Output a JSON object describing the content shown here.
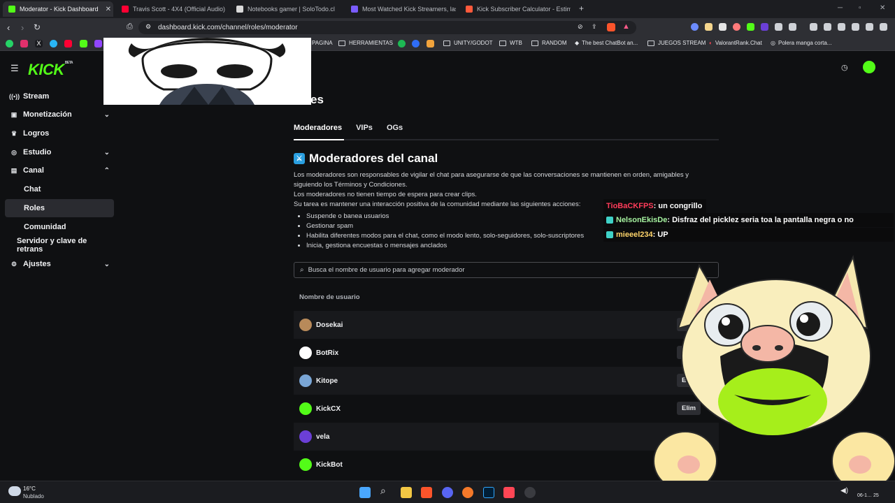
{
  "tabs": [
    {
      "label": "Moderator - Kick Dashboard",
      "active": true,
      "color": "#53fc18"
    },
    {
      "label": "Travis Scott - 4X4 (Official Audio)",
      "active": false,
      "color": "#ff0033"
    },
    {
      "label": "Notebooks gamer | SoloTodo.cl",
      "active": false,
      "color": "#d9d9d9"
    },
    {
      "label": "Most Watched Kick Streamers, last 7",
      "active": false,
      "color": "#7a5cff"
    },
    {
      "label": "Kick Subscriber Calculator - Estimate",
      "active": false,
      "color": "#ff5a3c"
    }
  ],
  "address": {
    "url": "dashboard.kick.com/channel/roles/moderator"
  },
  "bookmarks": [
    "PAGINA",
    "HERRAMIENTAS",
    "UNITY/GODOT",
    "WTB",
    "RANDOM",
    "The best ChatBot an...",
    "JUEGOS STREAM",
    "ValorantRank.Chat",
    "Polera manga corta..."
  ],
  "sidebar": {
    "logo": "KICK",
    "logo_sup": "BETA",
    "items": [
      {
        "label": "Stream",
        "icon": "broadcast-icon"
      },
      {
        "label": "Monetización",
        "icon": "money-icon"
      },
      {
        "label": "Logros",
        "icon": "trophy-icon"
      },
      {
        "label": "Estudio",
        "icon": "studio-icon"
      },
      {
        "label": "Canal",
        "icon": "channel-icon"
      }
    ],
    "sub": [
      "Chat",
      "Roles",
      "Comunidad"
    ],
    "server": "Servidor y clave de retrans",
    "settings": "Ajustes"
  },
  "page_title_partial": "es",
  "roles_tabs": [
    "Moderadores",
    "VIPs",
    "OGs"
  ],
  "section": {
    "title": "Moderadores del canal",
    "desc": [
      "Los moderadores son responsables de vigilar el chat para asegurarse de que las conversaciones se mantienen en orden, amigables y",
      "siguiendo los Términos y Condiciones.",
      "Los moderadores no tienen tiempo de espera para crear clips.",
      "Su tarea es mantener una interacción positiva de la comunidad mediante las siguientes acciones:"
    ],
    "bullets": [
      "Suspende o banea usuarios",
      "Gestionar spam",
      "Habilita diferentes modos para el chat, como el modo lento, solo-seguidores, solo-suscriptores",
      "Inicia, gestiona encuestas o mensajes anclados"
    ]
  },
  "search": {
    "placeholder": "Busca el nombre de usuario para agregar moderador"
  },
  "table": {
    "header": "Nombre de usuario",
    "rows": [
      {
        "name": "Dosekai",
        "action": "Elim",
        "avatar": "#b88a5a"
      },
      {
        "name": "BotRix",
        "action": "E",
        "avatar": "#ffffff"
      },
      {
        "name": "Kitope",
        "action": "Eli",
        "avatar": "#7aa6d6"
      },
      {
        "name": "KickCX",
        "action": "Elim",
        "avatar": "#53fc18"
      },
      {
        "name": "vela",
        "action": "",
        "avatar": "#6b3fd6"
      },
      {
        "name": "KickBot",
        "action": "",
        "avatar": "#53fc18"
      }
    ]
  },
  "chat_overlay": [
    {
      "user": "TioBaCKFPS",
      "msg": " : un congrillo",
      "color": "#ff3c5a",
      "badge": false
    },
    {
      "user": "NelsonEkisDe",
      "msg": " : Disfraz del picklez seria toa la pantalla negra o no",
      "color": "#a6f3a0",
      "badge": true
    },
    {
      "user": "mieeel234",
      "msg": " : UP",
      "color": "#ffd56b",
      "badge": true
    }
  ],
  "taskbar": {
    "temp": "16°C",
    "weather": "Nublado",
    "clock": "06-1… 25"
  }
}
